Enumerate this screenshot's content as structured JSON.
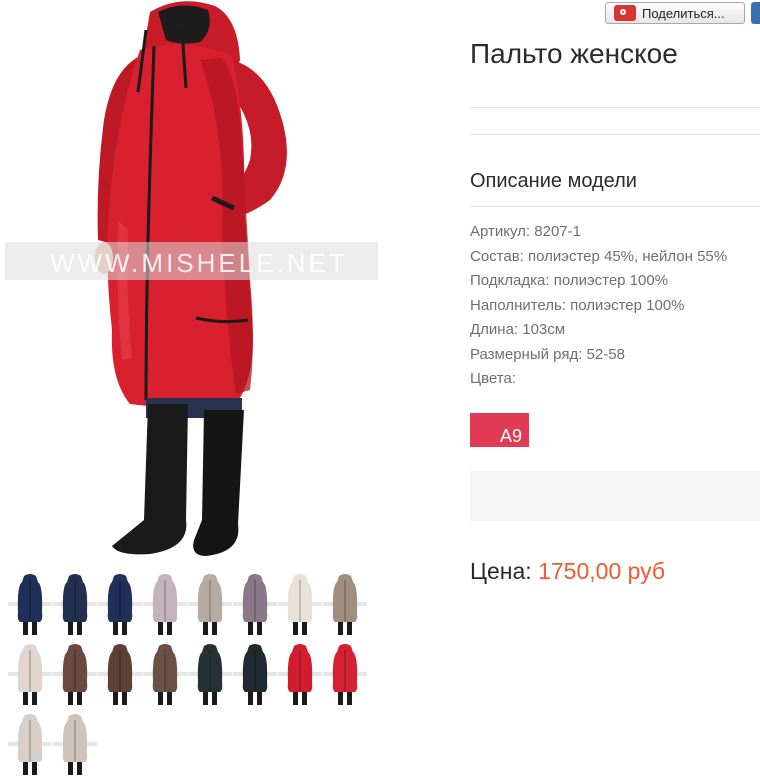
{
  "product": {
    "title": "Пальто женское",
    "photo_watermark": "WWW.MISHELE.NET",
    "description_heading": "Описание модели",
    "specs": [
      "Артикул: 8207-1",
      "Состав: полиэстер 45%, нейлон 55%",
      "Подкладка: полиэстер 100%",
      "Наполнитель: полиэстер 100%",
      "Длина: 103см",
      "Размерный ряд: 52-58",
      "Цвета:"
    ],
    "color_option": "A9",
    "price_label": "Цена:",
    "price_value": "1750,00 руб"
  },
  "share": {
    "label": "Поделиться..."
  },
  "colors": {
    "accent_price": "#ef5a30",
    "swatch_red": "#e03a55",
    "coat_red": "#d8202e"
  },
  "thumbnails": [
    {
      "icon": "coat-navy-thumb",
      "color": "#1f2f55"
    },
    {
      "icon": "coat-navy-thumb",
      "color": "#22304f"
    },
    {
      "icon": "coat-navy-thumb",
      "color": "#203058"
    },
    {
      "icon": "coat-lilac-thumb",
      "color": "#c4b3bd"
    },
    {
      "icon": "coat-grey-thumb",
      "color": "#b6aaa1"
    },
    {
      "icon": "coat-mauve-thumb",
      "color": "#8a7888"
    },
    {
      "icon": "coat-cream-thumb",
      "color": "#e7e1d8"
    },
    {
      "icon": "coat-taupe-thumb",
      "color": "#a08e7f"
    },
    {
      "icon": "coat-ivory-thumb",
      "color": "#e0d6cf"
    },
    {
      "icon": "coat-brown-thumb",
      "color": "#6a4a3e"
    },
    {
      "icon": "coat-brown-thumb",
      "color": "#5c4036"
    },
    {
      "icon": "coat-brown-thumb",
      "color": "#6a5046"
    },
    {
      "icon": "coat-darkteal-thumb",
      "color": "#243236"
    },
    {
      "icon": "coat-darkteal-thumb",
      "color": "#1f2b30"
    },
    {
      "icon": "coat-red-thumb",
      "color": "#d11e2e"
    },
    {
      "icon": "coat-red-thumb",
      "color": "#d52232"
    },
    {
      "icon": "coat-beige-thumb",
      "color": "#d8cfc8"
    },
    {
      "icon": "coat-beige-thumb",
      "color": "#cec4bc"
    }
  ]
}
